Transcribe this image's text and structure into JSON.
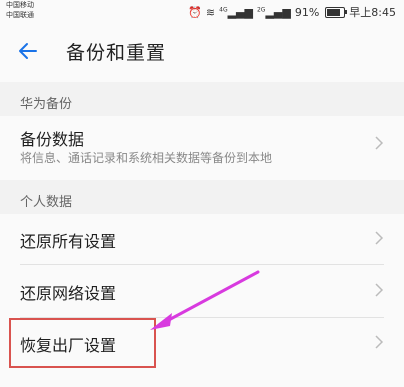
{
  "statusbar": {
    "carrier1": "中国移动",
    "carrier2": "中国联通",
    "net1": "4G",
    "net2": "2G",
    "battery": "91%",
    "time": "早上8:45",
    "battery_fill_fraction": 0.91
  },
  "header": {
    "title": "备份和重置",
    "back_icon": "back-arrow-icon"
  },
  "sections": [
    {
      "title": "华为备份",
      "items": [
        {
          "label": "备份数据",
          "subtitle": "将信息、通话记录和系统相关数据等备份到本地"
        }
      ]
    },
    {
      "title": "个人数据",
      "items": [
        {
          "label": "还原所有设置"
        },
        {
          "label": "还原网络设置"
        },
        {
          "label": "恢复出厂设置"
        }
      ]
    }
  ],
  "colors": {
    "accent": "#1a73e8",
    "highlight_border": "#d9534f",
    "annotation_arrow": "#d83adf"
  }
}
